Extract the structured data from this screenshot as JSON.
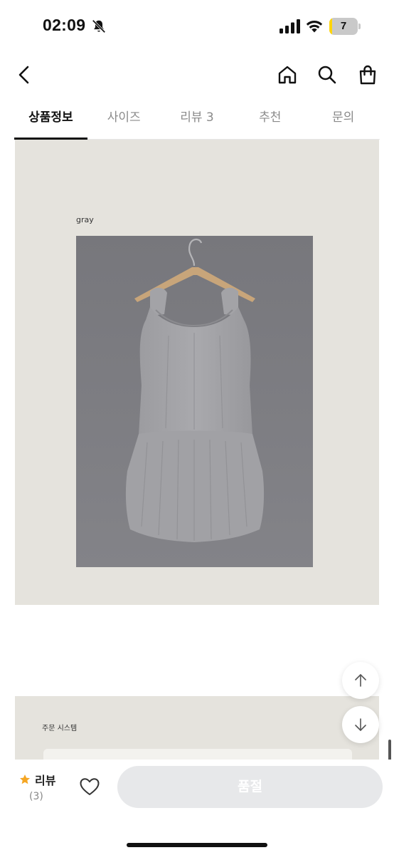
{
  "status_bar": {
    "time": "02:09",
    "battery_level": "7",
    "battery_fraction": 0.07,
    "icons": [
      "bell-slash-icon",
      "signal-icon",
      "wifi-icon",
      "battery-icon"
    ]
  },
  "header": {
    "icons": [
      "back-icon",
      "home-icon",
      "search-icon",
      "shopping-bag-icon"
    ]
  },
  "tabs": [
    {
      "label": "상품정보",
      "active": true
    },
    {
      "label": "사이즈",
      "active": false
    },
    {
      "label": "리뷰 3",
      "active": false
    },
    {
      "label": "추천",
      "active": false
    },
    {
      "label": "문의",
      "active": false
    }
  ],
  "product": {
    "color_label": "gray"
  },
  "order_section": {
    "title": "주문 시스템"
  },
  "bottom_bar": {
    "review_label": "리뷰",
    "review_count": "(3)",
    "soldout_label": "품절"
  },
  "colors": {
    "panel_bg": "#e5e3dd",
    "photo_bg": "#7c7c81",
    "star": "#f5a623",
    "soldout_bg": "#e7e8ea",
    "battery": "#ffd60a"
  }
}
